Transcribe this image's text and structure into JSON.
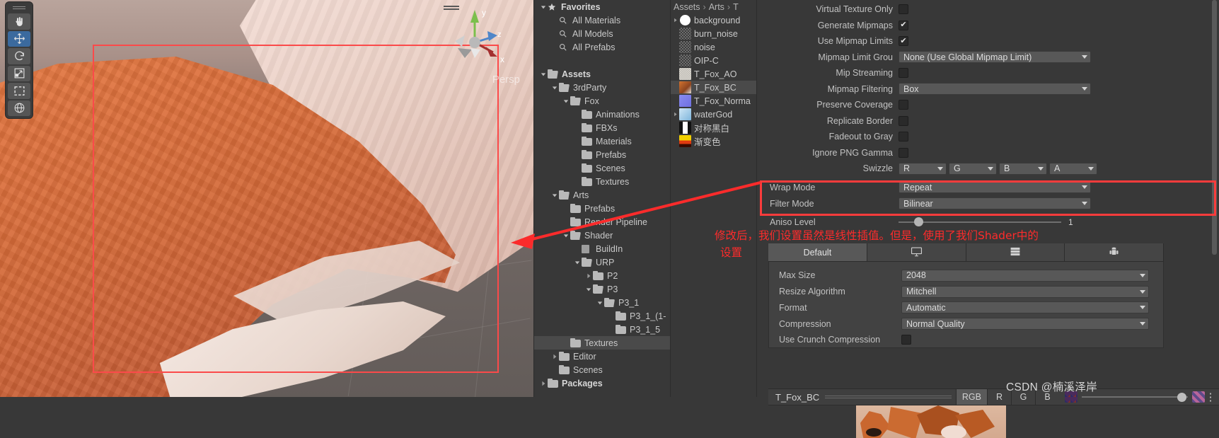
{
  "app": {
    "name": "Unity Editor",
    "watermark": "CSDN @楠溪泽岸"
  },
  "scene": {
    "tools": [
      {
        "name": "hand-tool",
        "label": "Hand",
        "active": false
      },
      {
        "name": "move-tool",
        "label": "Move",
        "active": true
      },
      {
        "name": "rotate-tool",
        "label": "Rotate",
        "active": false
      },
      {
        "name": "scale-tool",
        "label": "Scale",
        "active": false
      },
      {
        "name": "rect-tool",
        "label": "Rect",
        "active": false
      },
      {
        "name": "transform-tool",
        "label": "Transform",
        "active": false
      }
    ],
    "gizmo": {
      "x": "x",
      "y": "y",
      "z": "z"
    },
    "perspective_label": "Persp"
  },
  "project_tree": {
    "items": [
      {
        "label": "Favorites",
        "indent": 0,
        "arrow": "down",
        "icon": "star",
        "bold": true,
        "selected": false
      },
      {
        "label": "All Materials",
        "indent": 1,
        "arrow": "none",
        "icon": "search",
        "bold": false,
        "selected": false
      },
      {
        "label": "All Models",
        "indent": 1,
        "arrow": "none",
        "icon": "search",
        "bold": false,
        "selected": false
      },
      {
        "label": "All Prefabs",
        "indent": 1,
        "arrow": "none",
        "icon": "search",
        "bold": false,
        "selected": false
      },
      {
        "label": "",
        "indent": 0,
        "arrow": "none",
        "icon": "none",
        "bold": false,
        "selected": false
      },
      {
        "label": "Assets",
        "indent": 0,
        "arrow": "down",
        "icon": "folder-open",
        "bold": true,
        "selected": false
      },
      {
        "label": "3rdParty",
        "indent": 1,
        "arrow": "down",
        "icon": "folder-open",
        "bold": false,
        "selected": false
      },
      {
        "label": "Fox",
        "indent": 2,
        "arrow": "down",
        "icon": "folder-open",
        "bold": false,
        "selected": false
      },
      {
        "label": "Animations",
        "indent": 3,
        "arrow": "none",
        "icon": "folder",
        "bold": false,
        "selected": false
      },
      {
        "label": "FBXs",
        "indent": 3,
        "arrow": "none",
        "icon": "folder",
        "bold": false,
        "selected": false
      },
      {
        "label": "Materials",
        "indent": 3,
        "arrow": "none",
        "icon": "folder",
        "bold": false,
        "selected": false
      },
      {
        "label": "Prefabs",
        "indent": 3,
        "arrow": "none",
        "icon": "folder",
        "bold": false,
        "selected": false
      },
      {
        "label": "Scenes",
        "indent": 3,
        "arrow": "none",
        "icon": "folder",
        "bold": false,
        "selected": false
      },
      {
        "label": "Textures",
        "indent": 3,
        "arrow": "none",
        "icon": "folder",
        "bold": false,
        "selected": false
      },
      {
        "label": "Arts",
        "indent": 1,
        "arrow": "down",
        "icon": "folder-open",
        "bold": false,
        "selected": false
      },
      {
        "label": "Prefabs",
        "indent": 2,
        "arrow": "none",
        "icon": "folder",
        "bold": false,
        "selected": false
      },
      {
        "label": "Render Pipeline",
        "indent": 2,
        "arrow": "none",
        "icon": "folder",
        "bold": false,
        "selected": false
      },
      {
        "label": "Shader",
        "indent": 2,
        "arrow": "down",
        "icon": "folder-open",
        "bold": false,
        "selected": false
      },
      {
        "label": "BuildIn",
        "indent": 3,
        "arrow": "none",
        "icon": "folder-empty",
        "bold": false,
        "selected": false
      },
      {
        "label": "URP",
        "indent": 3,
        "arrow": "down",
        "icon": "folder-open",
        "bold": false,
        "selected": false
      },
      {
        "label": "P2",
        "indent": 4,
        "arrow": "right",
        "icon": "folder",
        "bold": false,
        "selected": false
      },
      {
        "label": "P3",
        "indent": 4,
        "arrow": "down",
        "icon": "folder-open",
        "bold": false,
        "selected": false
      },
      {
        "label": "P3_1",
        "indent": 5,
        "arrow": "down",
        "icon": "folder-open",
        "bold": false,
        "selected": false
      },
      {
        "label": "P3_1_(1-",
        "indent": 6,
        "arrow": "none",
        "icon": "folder",
        "bold": false,
        "selected": false
      },
      {
        "label": "P3_1_5",
        "indent": 6,
        "arrow": "none",
        "icon": "folder",
        "bold": false,
        "selected": false
      },
      {
        "label": "Textures",
        "indent": 2,
        "arrow": "none",
        "icon": "folder",
        "bold": false,
        "selected": true
      },
      {
        "label": "Editor",
        "indent": 1,
        "arrow": "right",
        "icon": "folder",
        "bold": false,
        "selected": false
      },
      {
        "label": "Scenes",
        "indent": 1,
        "arrow": "none",
        "icon": "folder",
        "bold": false,
        "selected": false
      },
      {
        "label": "Packages",
        "indent": 0,
        "arrow": "right",
        "icon": "folder",
        "bold": true,
        "selected": false
      }
    ]
  },
  "asset_list": {
    "breadcrumb": [
      "Assets",
      "Arts",
      "T"
    ],
    "items": [
      {
        "label": "background",
        "arrow": "right",
        "thumb": "white-circle",
        "selected": false
      },
      {
        "label": "burn_noise",
        "arrow": "none",
        "thumb": "grey-noise",
        "selected": false
      },
      {
        "label": "noise",
        "arrow": "none",
        "thumb": "grey-noise",
        "selected": false
      },
      {
        "label": "OIP-C",
        "arrow": "none",
        "thumb": "grey-noise",
        "selected": false
      },
      {
        "label": "T_Fox_AO",
        "arrow": "none",
        "thumb": "light-noise",
        "selected": false
      },
      {
        "label": "T_Fox_BC",
        "arrow": "none",
        "thumb": "fox-orange",
        "selected": true
      },
      {
        "label": "T_Fox_Norma",
        "arrow": "none",
        "thumb": "normal-blue",
        "selected": false
      },
      {
        "label": "waterGod",
        "arrow": "right",
        "thumb": "char-icon",
        "selected": false
      },
      {
        "label": "对称黑白",
        "arrow": "none",
        "thumb": "bw-gradient",
        "selected": false
      },
      {
        "label": "渐变色",
        "arrow": "none",
        "thumb": "color-ramp",
        "selected": false
      }
    ]
  },
  "inspector": {
    "fields": [
      {
        "label": "Virtual Texture Only",
        "type": "checkbox",
        "value": false
      },
      {
        "label": "Generate Mipmaps",
        "type": "checkbox",
        "value": true
      },
      {
        "label": "Use Mipmap Limits",
        "type": "checkbox",
        "value": true
      },
      {
        "label": "Mipmap Limit Grou",
        "type": "dropdown",
        "value": "None (Use Global Mipmap Limit)"
      },
      {
        "label": "Mip Streaming",
        "type": "checkbox",
        "value": false
      },
      {
        "label": "Mipmap Filtering",
        "type": "dropdown",
        "value": "Box"
      },
      {
        "label": "Preserve Coverage",
        "type": "checkbox",
        "value": false
      },
      {
        "label": "Replicate Border",
        "type": "checkbox",
        "value": false
      },
      {
        "label": "Fadeout to Gray",
        "type": "checkbox",
        "value": false
      },
      {
        "label": "Ignore PNG Gamma",
        "type": "checkbox",
        "value": false
      }
    ],
    "swizzle": {
      "label": "Swizzle",
      "channels": [
        "R",
        "G",
        "B",
        "A"
      ]
    },
    "wrap_mode": {
      "label": "Wrap Mode",
      "value": "Repeat"
    },
    "filter_mode": {
      "label": "Filter Mode",
      "value": "Bilinear"
    },
    "aniso_level": {
      "label": "Aniso Level",
      "value": "1"
    },
    "platform_tabs": [
      {
        "label": "Default",
        "icon": "none",
        "active": true
      },
      {
        "label": "",
        "icon": "monitor-icon",
        "active": false
      },
      {
        "label": "",
        "icon": "server-icon",
        "active": false
      },
      {
        "label": "",
        "icon": "android-icon",
        "active": false
      }
    ],
    "platform_fields": [
      {
        "label": "Max Size",
        "type": "dropdown",
        "value": "2048"
      },
      {
        "label": "Resize Algorithm",
        "type": "dropdown",
        "value": "Mitchell"
      },
      {
        "label": "Format",
        "type": "dropdown",
        "value": "Automatic"
      },
      {
        "label": "Compression",
        "type": "dropdown",
        "value": "Normal Quality"
      },
      {
        "label": "Use Crunch Compression",
        "type": "checkbox",
        "value": false
      }
    ]
  },
  "preview": {
    "asset_name": "T_Fox_BC",
    "channel_buttons": [
      {
        "label": "RGB",
        "active": true
      },
      {
        "label": "R",
        "active": false
      },
      {
        "label": "G",
        "active": false
      },
      {
        "label": "B",
        "active": false
      }
    ],
    "menu_icon": "kebab-menu-icon"
  },
  "annotations": {
    "line1": "修改后，我们设置虽然是线性插值。但是，使用了我们Shader中的",
    "line2": "设置",
    "highlight_color": "#fb3c3c"
  }
}
